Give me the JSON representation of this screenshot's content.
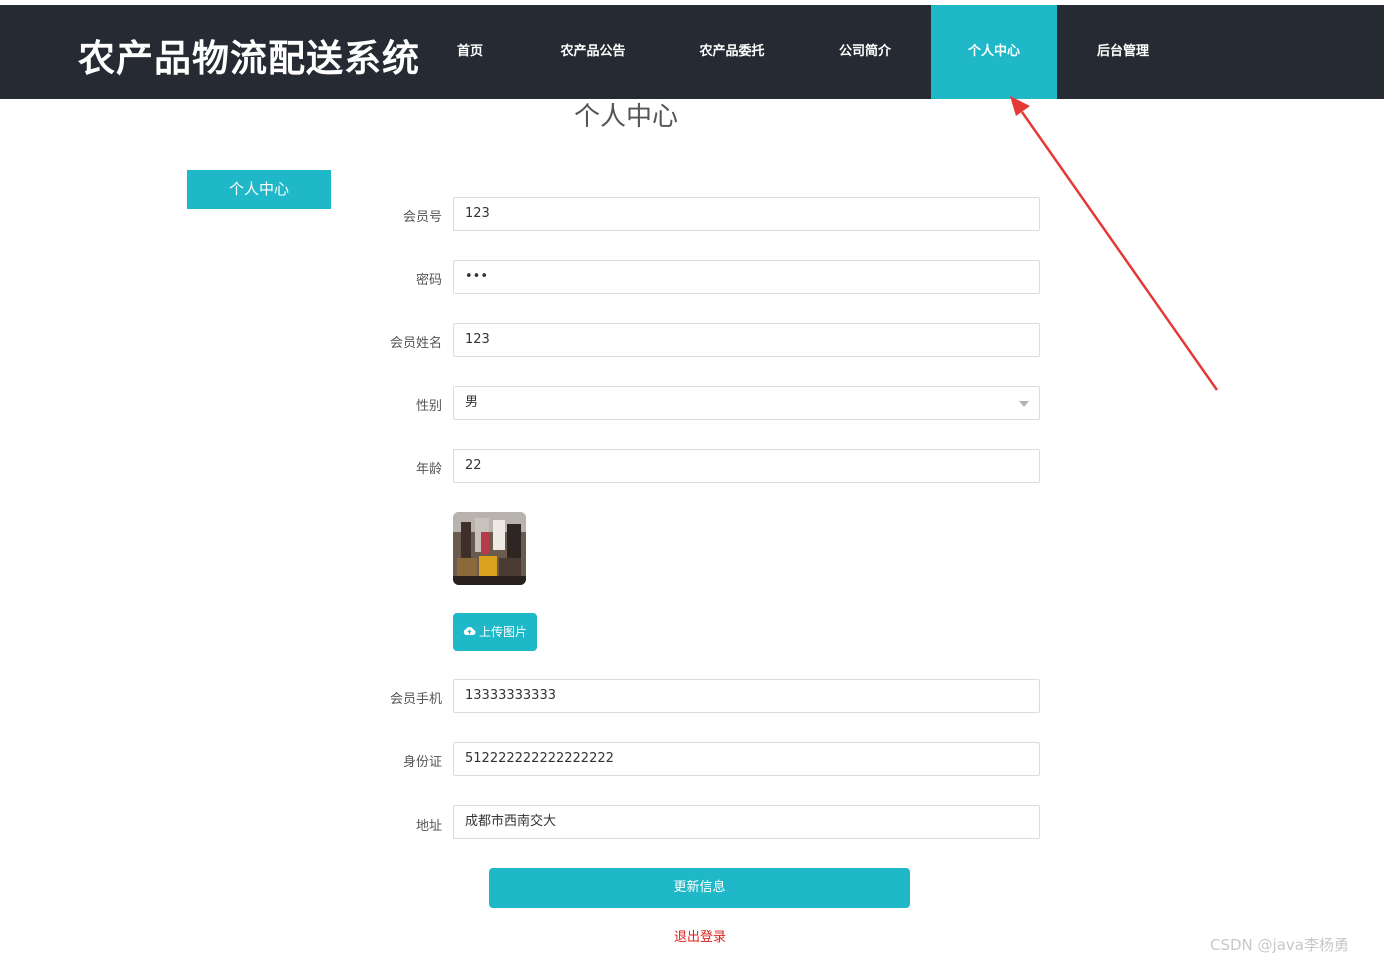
{
  "header": {
    "brand": "农产品物流配送系统",
    "nav": [
      {
        "label": "首页"
      },
      {
        "label": "农产品公告"
      },
      {
        "label": "农产品委托"
      },
      {
        "label": "公司简介"
      },
      {
        "label": "个人中心",
        "active": true
      },
      {
        "label": "后台管理"
      }
    ]
  },
  "page_title": "个人中心",
  "sidebar": {
    "button_label": "个人中心"
  },
  "form": {
    "member_no": {
      "label": "会员号",
      "value": "123"
    },
    "password": {
      "label": "密码",
      "value": "•••"
    },
    "member_name": {
      "label": "会员姓名",
      "value": "123"
    },
    "gender": {
      "label": "性别",
      "value": "男"
    },
    "age": {
      "label": "年龄",
      "value": "22"
    },
    "upload_label": "上传图片",
    "phone": {
      "label": "会员手机",
      "value": "13333333333"
    },
    "id_card": {
      "label": "身份证",
      "value": "512222222222222222"
    },
    "address": {
      "label": "地址",
      "value": "成都市西南交大"
    },
    "submit_label": "更新信息",
    "logout_label": "退出登录"
  },
  "watermark": "CSDN @java李杨勇",
  "colors": {
    "accent": "#1fb8c8",
    "header_bg": "#262a33",
    "logout": "#e0201c",
    "annotation_arrow": "#e53935"
  }
}
